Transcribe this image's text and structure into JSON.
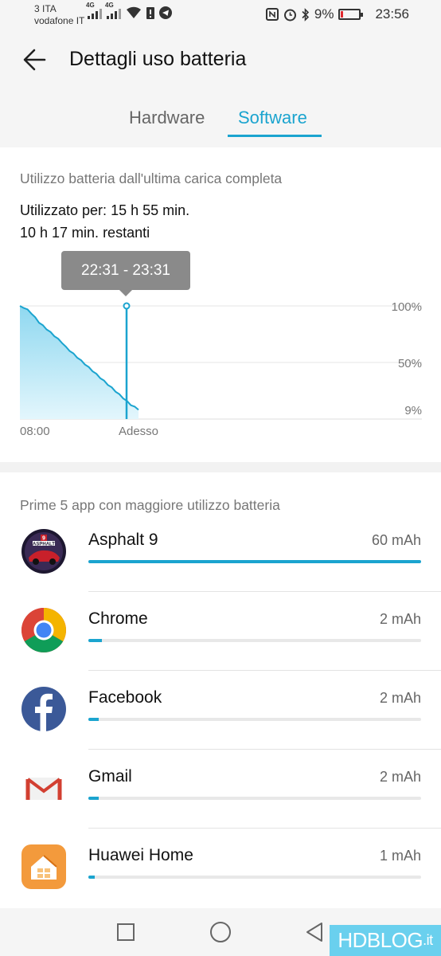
{
  "status_bar": {
    "carrier_line1": "3 ITA",
    "carrier_line2": "vodafone IT",
    "signal_tag": "4G",
    "battery_percent": "9%",
    "battery_level": 0.09,
    "time": "23:56"
  },
  "header": {
    "title": "Dettagli uso batteria",
    "tabs": [
      {
        "label": "Hardware",
        "active": false
      },
      {
        "label": "Software",
        "active": true
      }
    ]
  },
  "usage": {
    "heading": "Utilizzo batteria dall'ultima carica completa",
    "used_label": "Utilizzato per:",
    "used_value": "15 h 55 min.",
    "remaining": "10 h 17 min. restanti"
  },
  "chart_data": {
    "type": "area",
    "tooltip": "22:31 - 23:31",
    "x_labels": [
      "08:00",
      "Adesso"
    ],
    "y_ticks": [
      "100%",
      "50%",
      "9%"
    ],
    "ylim": [
      0,
      100
    ],
    "series": [
      {
        "values": [
          100,
          99,
          97,
          94,
          90,
          86,
          83,
          80,
          77,
          74,
          71,
          68,
          64,
          61,
          58,
          55,
          52,
          49,
          46,
          43,
          40,
          37,
          34,
          31,
          28,
          25,
          22,
          19,
          16,
          13,
          11,
          9
        ]
      }
    ],
    "color": "#1ba4cf"
  },
  "apps": {
    "heading": "Prime 5 app con maggiore utilizzo batteria",
    "items": [
      {
        "name": "Asphalt 9",
        "mah": "60 mAh",
        "fraction": 1.0,
        "icon": "asphalt-icon"
      },
      {
        "name": "Chrome",
        "mah": "2 mAh",
        "fraction": 0.04,
        "icon": "chrome-icon"
      },
      {
        "name": "Facebook",
        "mah": "2 mAh",
        "fraction": 0.03,
        "icon": "facebook-icon"
      },
      {
        "name": "Gmail",
        "mah": "2 mAh",
        "fraction": 0.03,
        "icon": "gmail-icon"
      },
      {
        "name": "Huawei Home",
        "mah": "1 mAh",
        "fraction": 0.02,
        "icon": "huawei-home-icon"
      }
    ]
  },
  "watermark": {
    "text": "HDBLOG",
    "suffix": ".it"
  },
  "colors": {
    "accent": "#1ba4cf",
    "battery_low": "#e0292e"
  }
}
